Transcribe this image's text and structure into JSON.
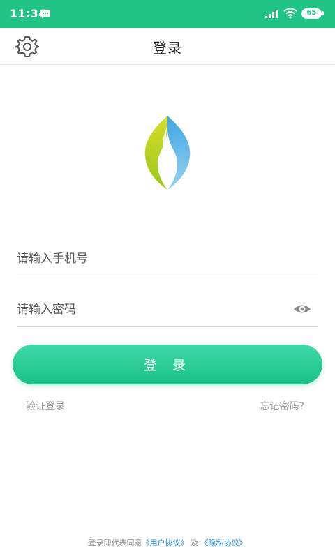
{
  "status_bar": {
    "time": "11:34",
    "battery": "65"
  },
  "header": {
    "title": "登录"
  },
  "form": {
    "phone_placeholder": "请输入手机号",
    "phone_value": "",
    "password_placeholder": "请输入密码",
    "password_value": "",
    "login_label": "登 录"
  },
  "links": {
    "verify_login": "验证登录",
    "forgot_password": "忘记密码?"
  },
  "agreement": {
    "prefix": "登录即代表同意",
    "user_agreement": "《用户协议》",
    "conjunction": "及",
    "privacy_policy": "《隐私协议》"
  },
  "icons": {
    "settings": "gear-icon",
    "eye": "eye-icon",
    "message": "message-icon",
    "signal": "signal-icon",
    "wifi": "wifi-icon"
  },
  "colors": {
    "accent": "#20c484",
    "button_gradient_top": "#3fd9a8",
    "button_gradient_bottom": "#19c185",
    "link_blue": "#1e88d2",
    "logo_green": "#b8cf1e",
    "logo_blue": "#3aa9e0"
  }
}
